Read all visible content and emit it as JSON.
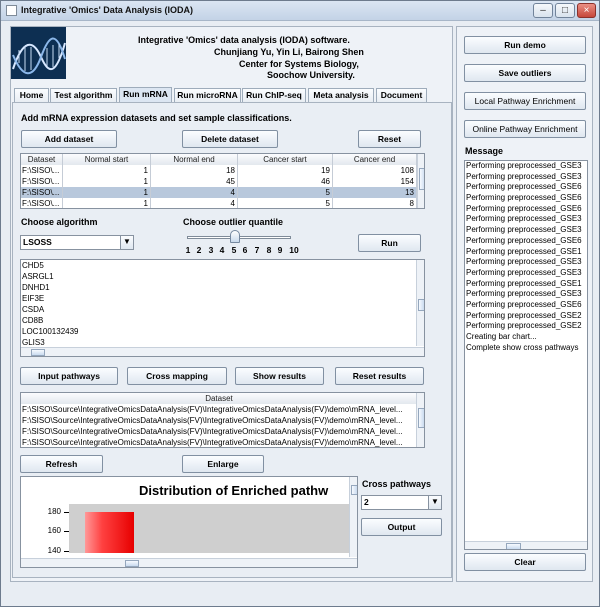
{
  "window": {
    "title": "Integrative 'Omics' Data Analysis (IODA)",
    "controls": [
      "–",
      "□",
      "×"
    ]
  },
  "header": {
    "line1": "Integrative 'Omics' data analysis (IODA) software.",
    "line2": "Chunjiang Yu, Yin Li, Bairong Shen",
    "line3": "Center for Systems Biology,",
    "line4": "Soochow University."
  },
  "tabs": [
    {
      "label": "Home"
    },
    {
      "label": "Test algorithm"
    },
    {
      "label": "Run mRNA"
    },
    {
      "label": "Run microRNA"
    },
    {
      "label": "Run ChIP-seq"
    },
    {
      "label": "Meta analysis"
    },
    {
      "label": "Document"
    }
  ],
  "instruction": "Add mRNA expression datasets and set sample classifications.",
  "buttons": {
    "add_dataset": "Add dataset",
    "delete_dataset": "Delete dataset",
    "reset": "Reset",
    "run": "Run",
    "input_pathways": "Input pathways",
    "cross_mapping": "Cross mapping",
    "show_results": "Show results",
    "reset_results": "Reset results",
    "refresh": "Refresh",
    "enlarge": "Enlarge",
    "output": "Output",
    "run_demo": "Run demo",
    "save_outliers": "Save outliers",
    "local_pathway": "Local Pathway Enrichment",
    "online_pathway": "Online Pathway Enrichment",
    "clear": "Clear"
  },
  "dataset_table": {
    "columns": [
      "Dataset",
      "Normal start",
      "Normal end",
      "Cancer start",
      "Cancer end"
    ],
    "rows": [
      [
        "F:\\SISO\\...",
        "1",
        "18",
        "19",
        "108"
      ],
      [
        "F:\\SISO\\...",
        "1",
        "45",
        "46",
        "154"
      ],
      [
        "F:\\SISO\\...",
        "1",
        "4",
        "5",
        "13"
      ],
      [
        "F:\\SISO\\...",
        "1",
        "4",
        "5",
        "8"
      ]
    ],
    "selected_row": 3
  },
  "algorithm": {
    "label": "Choose algorithm",
    "selected": "LSOSS"
  },
  "quantile": {
    "label": "Choose outlier quantile",
    "ticks": [
      "1",
      "2",
      "3",
      "4",
      "5",
      "6",
      "7",
      "8",
      "9",
      "10"
    ],
    "value": 5
  },
  "gene_list": [
    "CHD5",
    "ASRGL1",
    "DNHD1",
    "EIF3E",
    "CSDA",
    "CD8B",
    "LOC100132439",
    "GLIS3"
  ],
  "dataset_paths": {
    "header": "Dataset",
    "rows": [
      "F:\\SISO\\Source\\IntegrativeOmicsDataAnalysis(FV)\\IntegrativeOmicsDataAnalysis(FV)\\demo\\mRNA_level...",
      "F:\\SISO\\Source\\IntegrativeOmicsDataAnalysis(FV)\\IntegrativeOmicsDataAnalysis(FV)\\demo\\mRNA_level...",
      "F:\\SISO\\Source\\IntegrativeOmicsDataAnalysis(FV)\\IntegrativeOmicsDataAnalysis(FV)\\demo\\mRNA_level...",
      "F:\\SISO\\Source\\IntegrativeOmicsDataAnalysis(FV)\\IntegrativeOmicsDataAnalysis(FV)\\demo\\mRNA_level..."
    ]
  },
  "chart_data": {
    "type": "bar",
    "title": "Distribution of Enriched pathw",
    "yticks": [
      "180",
      "160",
      "140"
    ],
    "ylim": [
      138,
      188
    ],
    "categories": [
      ""
    ],
    "values": [
      180
    ],
    "colors": [
      "#e70000"
    ]
  },
  "cross_pathways": {
    "label": "Cross pathways",
    "selected": "2"
  },
  "message": {
    "label": "Message",
    "lines": [
      "Performing preprocessed_GSE3",
      "Performing preprocessed_GSE3",
      "Performing preprocessed_GSE6",
      "Performing preprocessed_GSE6",
      "Performing preprocessed_GSE6",
      "Performing preprocessed_GSE3",
      "Performing preprocessed_GSE3",
      "Performing preprocessed_GSE6",
      "Performing preprocessed_GSE1",
      "Performing preprocessed_GSE3",
      "Performing preprocessed_GSE3",
      "Performing preprocessed_GSE1",
      "Performing preprocessed_GSE3",
      "Performing preprocessed_GSE6",
      "Performing preprocessed_GSE2",
      "Performing preprocessed_GSE2",
      "Creating bar chart...",
      "Complete show cross pathways"
    ]
  },
  "colors": {
    "window_bg": "#e8edf3",
    "panel_bg": "#eef2f7",
    "selection": "#b8c8dc",
    "bar_red": "#e70000"
  },
  "icons": {
    "dna_banner": "dna-banner-icon",
    "app": "app-icon",
    "dropdown": "chevron-down-icon"
  }
}
